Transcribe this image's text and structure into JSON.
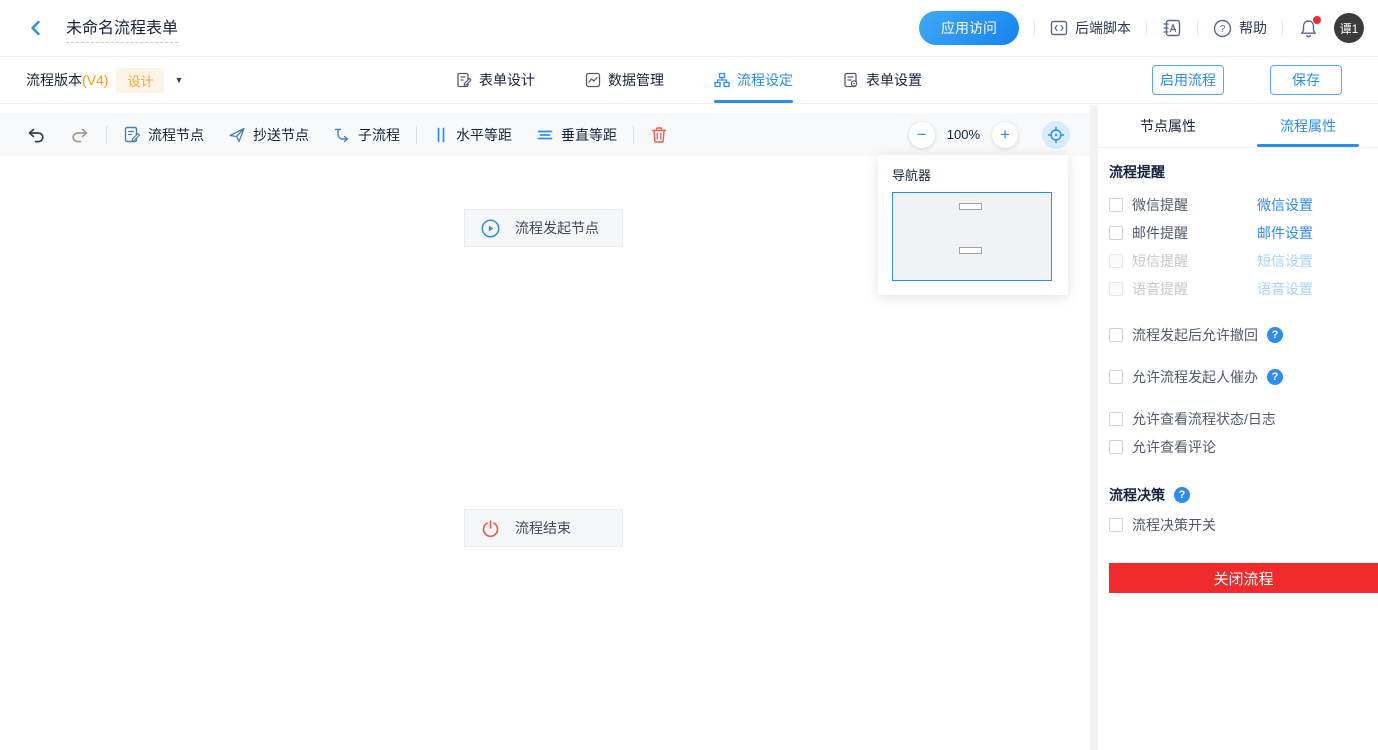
{
  "header": {
    "title": "未命名流程表单",
    "app_access_button": "应用访问",
    "backend_script_label": "后端脚本",
    "help_label": "帮助",
    "avatar_text": "谭1",
    "code_icon_glyph": "</>",
    "help_icon_glyph": "?"
  },
  "subheader": {
    "version_label": "流程版本",
    "version_value": "(V4)",
    "design_tag": "设计",
    "caret_glyph": "▼",
    "tabs": [
      {
        "label": "表单设计"
      },
      {
        "label": "数据管理"
      },
      {
        "label": "流程设定"
      },
      {
        "label": "表单设置"
      }
    ],
    "enable_button": "启用流程",
    "save_button": "保存"
  },
  "toolbar": {
    "node_button": "流程节点",
    "cc_button": "抄送节点",
    "subflow_button": "子流程",
    "h_space_button": "水平等距",
    "v_space_button": "垂直等距",
    "zoom_out_glyph": "−",
    "zoom_level": "100%",
    "zoom_in_glyph": "+"
  },
  "canvas": {
    "start_node_label": "流程发起节点",
    "end_node_label": "流程结束",
    "navigator_title": "导航器"
  },
  "panel": {
    "tabs": [
      {
        "label": "节点属性"
      },
      {
        "label": "流程属性"
      }
    ],
    "reminder_header": "流程提醒",
    "reminders": [
      {
        "label": "微信提醒",
        "link": "微信设置"
      },
      {
        "label": "邮件提醒",
        "link": "邮件设置"
      },
      {
        "label": "短信提醒",
        "link": "短信设置"
      },
      {
        "label": "语音提醒",
        "link": "语音设置"
      }
    ],
    "options": [
      {
        "label": "流程发起后允许撤回"
      },
      {
        "label": "允许流程发起人催办"
      },
      {
        "label": "允许查看流程状态/日志"
      },
      {
        "label": "允许查看评论"
      }
    ],
    "help_glyph": "?",
    "decision_header": "流程决策",
    "decision_toggle_label": "流程决策开关",
    "close_button": "关闭流程"
  },
  "colors": {
    "accent_blue": "#2d8cf0",
    "disabled_link_blue": "#a6d4fb",
    "tag_orange": "#f5a53f",
    "version_orange": "#ff9900",
    "close_red": "#f12b2b",
    "trash_red": "#ef5e4e"
  }
}
